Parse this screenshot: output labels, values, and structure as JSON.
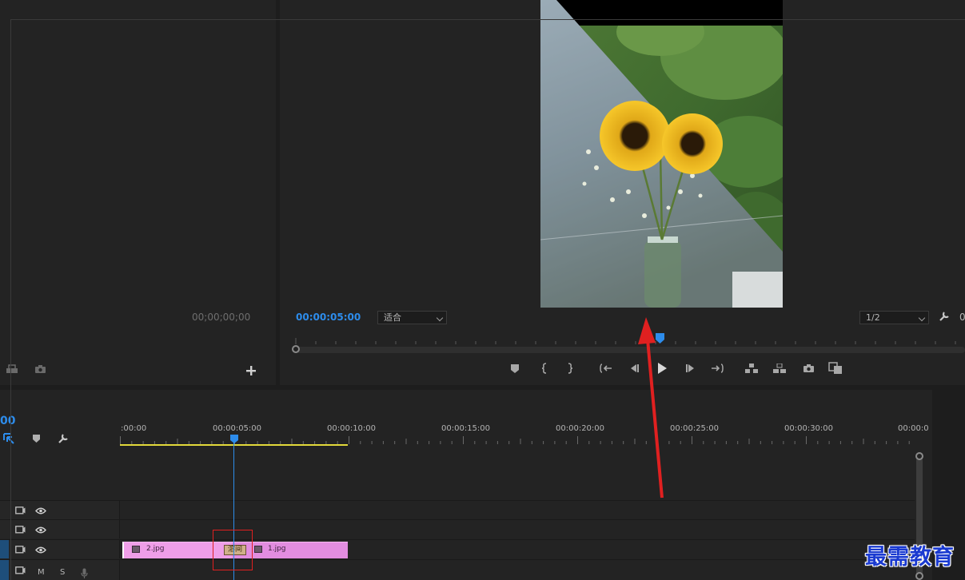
{
  "source_monitor": {
    "timecode": "00;00;00;00"
  },
  "program_monitor": {
    "timecode": "00:00:05:00",
    "zoom_select": "适合",
    "resolution_select": "1/2",
    "trailing_char": "0"
  },
  "timeline": {
    "current_time_fragment": "00",
    "ruler_labels": [
      ":00:00",
      "00:00:05:00",
      "00:00:10:00",
      "00:00:15:00",
      "00:00:20:00",
      "00:00:25:00",
      "00:00:30:00",
      "00:00:0"
    ],
    "tracks": {
      "track3_buttons": [
        "M",
        "S"
      ]
    },
    "clips": [
      {
        "name": "2.jpg"
      },
      {
        "name": "1.jpg"
      }
    ],
    "transition_label": "溶间"
  },
  "watermark": "最需教育",
  "colors": {
    "accent_blue": "#2d8ceb",
    "clip_pink": "#e28de0",
    "workarea_yellow": "#e2d93a",
    "annotation_red": "#e02020"
  }
}
